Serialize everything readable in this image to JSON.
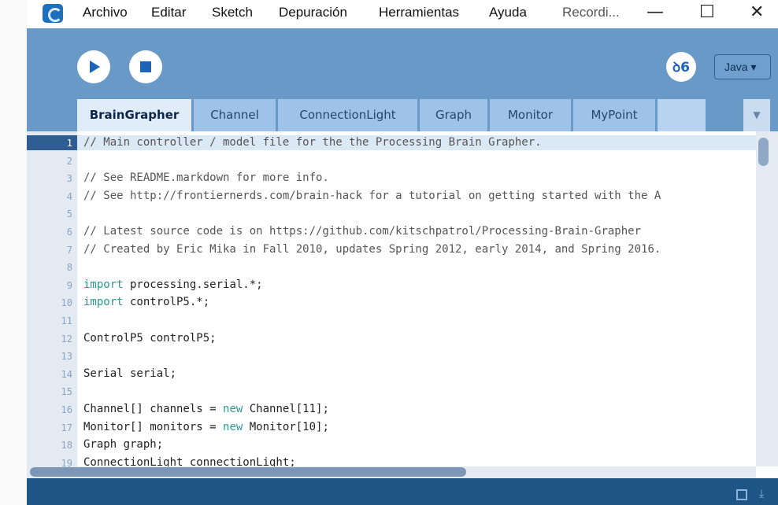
{
  "menubar": {
    "items": [
      "Archivo",
      "Editar",
      "Sketch",
      "Depuración",
      "Herramientas",
      "Ayuda",
      "Recordi..."
    ]
  },
  "window_controls": {
    "minimize": "—",
    "maximize": "☐",
    "close": "✕"
  },
  "toolbar": {
    "mode_label": "Java ▾",
    "debug_glyph": "ꝺ6"
  },
  "tabs": {
    "items": [
      "BrainGrapher",
      "Channel",
      "ConnectionLight",
      "Graph",
      "Monitor",
      "MyPoint",
      ""
    ],
    "active": "BrainGrapher",
    "more_glyph": "▼"
  },
  "editor": {
    "current_line": 1,
    "line_numbers": [
      "1",
      "2",
      "3",
      "4",
      "5",
      "6",
      "7",
      "8",
      "9",
      "10",
      "11",
      "12",
      "13",
      "14",
      "15",
      "16",
      "17",
      "18",
      "19"
    ],
    "lines": [
      "// Main controller / model file for the the Processing Brain Grapher.",
      "",
      "// See README.markdown for more info.",
      "// See http://frontiernerds.com/brain-hack for a tutorial on getting started with the A",
      "",
      "// Latest source code is on https://github.com/kitschpatrol/Processing-Brain-Grapher",
      "// Created by Eric Mika in Fall 2010, updates Spring 2012, early 2014, and Spring 2016.",
      "",
      "import processing.serial.*;",
      "import controlP5.*;",
      "",
      "ControlP5 controlP5;",
      "",
      "Serial serial;",
      "",
      "Channel[] channels = new Channel[11];",
      "Monitor[] monitors = new Monitor[10];",
      "Graph graph;",
      "ConnectionLight connectionLight;"
    ]
  },
  "colors": {
    "toolbar_bg": "#6999c7",
    "footer_bg": "#1d5586",
    "keyword": "#2c9a8f",
    "accent": "#1c63b9"
  }
}
